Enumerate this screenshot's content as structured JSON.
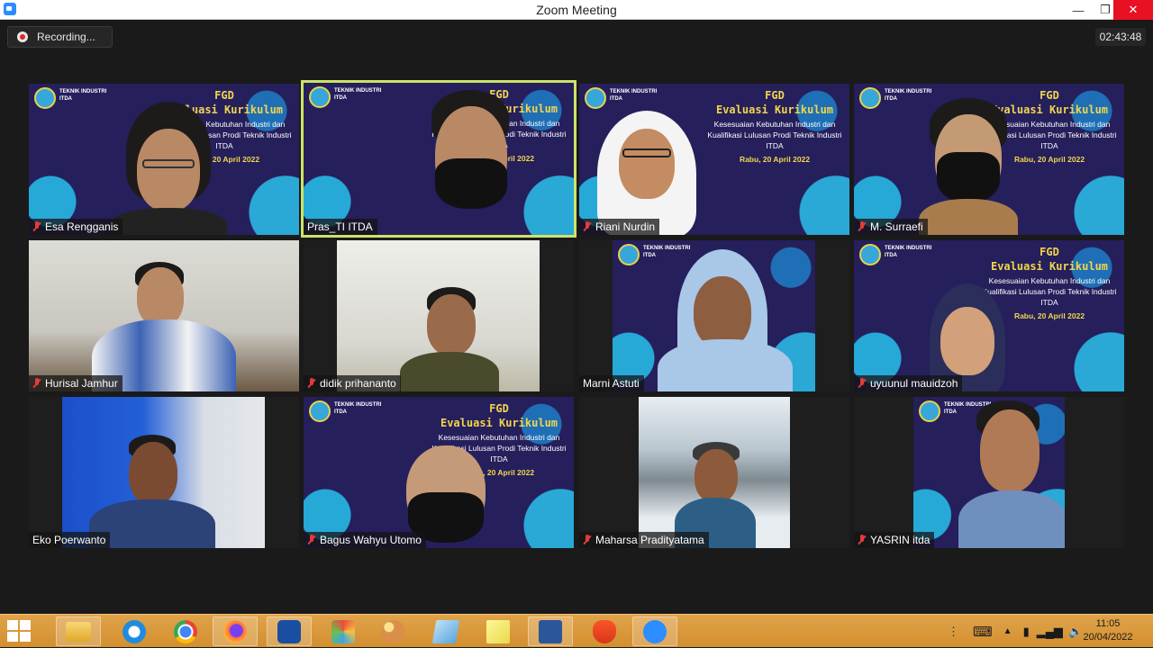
{
  "window": {
    "title": "Zoom Meeting",
    "minimize_label": "—",
    "maximize_label": "❐",
    "close_label": "✕"
  },
  "meeting": {
    "recording_label": "Recording...",
    "timer": "02:43:48"
  },
  "slide": {
    "brand": "TEKNIK INDUSTRI\nITDA",
    "heading": "FGD",
    "title": "Evaluasi Kurikulum",
    "subtitle": "Kesesuaian Kebutuhan Industri dan Kualifikasi Lulusan Prodi Teknik Industri ITDA",
    "date": "Rabu, 20 April 2022"
  },
  "participants": [
    {
      "name": "Esa Rengganis",
      "muted": true,
      "active": false
    },
    {
      "name": "Pras_TI ITDA",
      "muted": false,
      "active": true
    },
    {
      "name": "Riani Nurdin",
      "muted": true,
      "active": false
    },
    {
      "name": "M. Surraefi",
      "muted": true,
      "active": false
    },
    {
      "name": "Hurisal Jamhur",
      "muted": true,
      "active": false
    },
    {
      "name": "didik prihananto",
      "muted": true,
      "active": false
    },
    {
      "name": "Marni Astuti",
      "muted": false,
      "active": false
    },
    {
      "name": "uyuunul mauidzoh",
      "muted": true,
      "active": false
    },
    {
      "name": "Eko Poerwanto",
      "muted": false,
      "active": false
    },
    {
      "name": "Bagus Wahyu Utomo",
      "muted": true,
      "active": false
    },
    {
      "name": "Maharsa Pradityatama",
      "muted": true,
      "active": false
    },
    {
      "name": "YASRIN itda",
      "muted": true,
      "active": false
    }
  ],
  "taskbar": {
    "apps": [
      "file-explorer",
      "internet-explorer",
      "chrome",
      "firefox",
      "vpn",
      "paint",
      "paint-3d",
      "notepad",
      "sticky-notes",
      "word",
      "brave",
      "zoom"
    ],
    "time": "11:05",
    "date": "20/04/2022"
  }
}
